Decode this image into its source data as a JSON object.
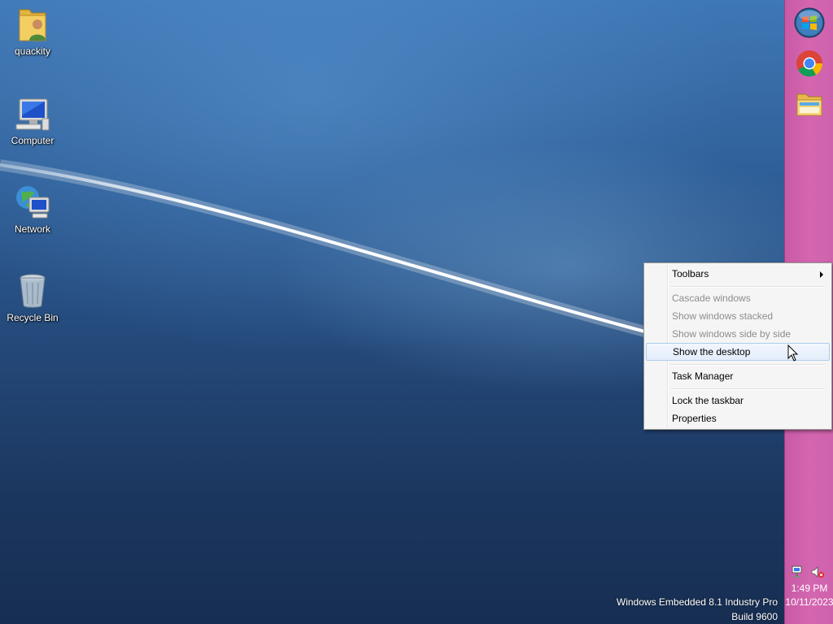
{
  "desktop": {
    "icons": [
      {
        "label": "quackity",
        "icon": "user-folder-icon"
      },
      {
        "label": "Computer",
        "icon": "computer-icon"
      },
      {
        "label": "Network",
        "icon": "network-icon"
      },
      {
        "label": "Recycle Bin",
        "icon": "recycle-bin-icon"
      }
    ],
    "watermark": {
      "line1": "Windows Embedded 8.1 Industry Pro",
      "line2": "Build 9600"
    }
  },
  "taskbar": {
    "orientation": "vertical-right",
    "color": "#d466b0",
    "buttons": [
      {
        "icon": "start-orb-icon"
      },
      {
        "icon": "chrome-icon"
      },
      {
        "icon": "file-explorer-icon"
      }
    ],
    "tray": {
      "icons": [
        "network-tray-icon",
        "speaker-muted-icon"
      ],
      "time": "1:49 PM",
      "date": "10/11/2023"
    }
  },
  "context_menu": {
    "items": [
      {
        "label": "Toolbars",
        "state": "enabled",
        "submenu": true
      },
      {
        "label": "Cascade windows",
        "state": "disabled"
      },
      {
        "label": "Show windows stacked",
        "state": "disabled"
      },
      {
        "label": "Show windows side by side",
        "state": "disabled"
      },
      {
        "label": "Show the desktop",
        "state": "hover"
      },
      {
        "label": "Task Manager",
        "state": "enabled"
      },
      {
        "label": "Lock the taskbar",
        "state": "enabled"
      },
      {
        "label": "Properties",
        "state": "enabled"
      }
    ]
  }
}
